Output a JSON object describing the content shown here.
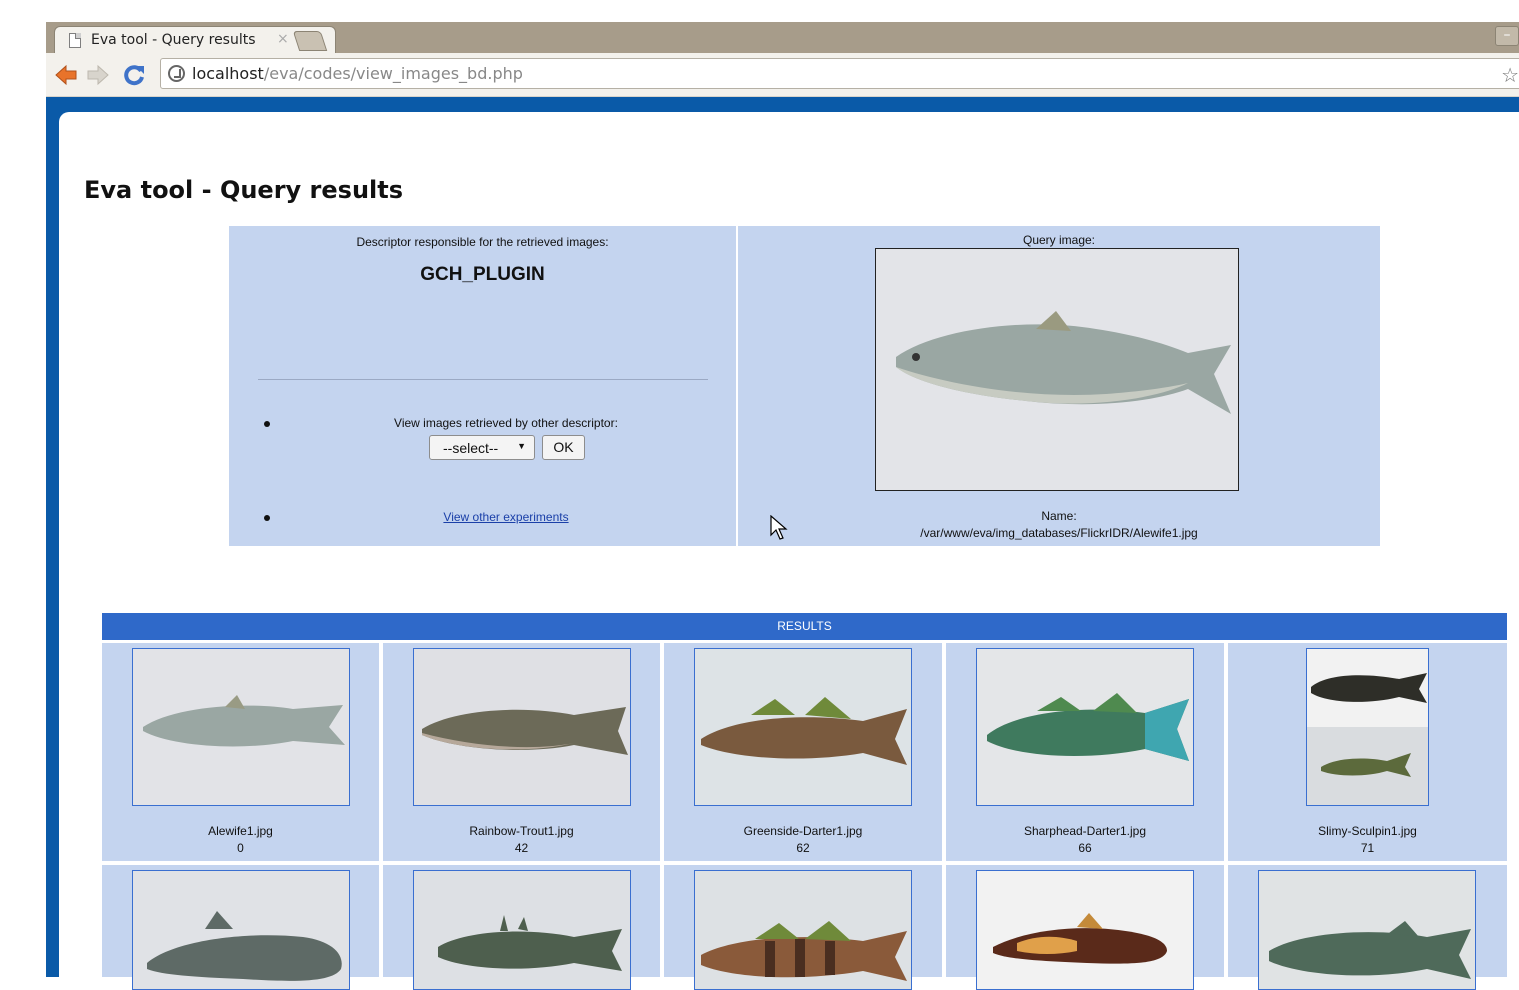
{
  "browser": {
    "tab_title": "Eva tool - Query results",
    "tab_close": "×",
    "url_host": "localhost",
    "url_path": "/eva/codes/view_images_bd.php"
  },
  "page": {
    "title": "Eva tool - Query results"
  },
  "descriptor": {
    "caption": "Descriptor responsible for the retrieved images:",
    "name": "GCH_PLUGIN",
    "other_label": "View images retrieved by other descriptor:",
    "select_value": "--select--",
    "ok_label": "OK",
    "experiments_link": "View other experiments"
  },
  "query": {
    "caption": "Query image:",
    "name_label": "Name:",
    "name_value": "/var/www/eva/img_databases/FlickrIDR/Alewife1.jpg"
  },
  "results": {
    "header": "RESULTS",
    "items": [
      {
        "name": "Alewife1.jpg",
        "score": "0"
      },
      {
        "name": "Rainbow-Trout1.jpg",
        "score": "42"
      },
      {
        "name": "Greenside-Darter1.jpg",
        "score": "62"
      },
      {
        "name": "Sharphead-Darter1.jpg",
        "score": "66"
      },
      {
        "name": "Slimy-Sculpin1.jpg",
        "score": "71"
      }
    ]
  },
  "colors": {
    "page_frame": "#0a5aa8",
    "panel": "#c4d4ef",
    "results_header": "#2f69c9",
    "link": "#1a3fa8"
  }
}
